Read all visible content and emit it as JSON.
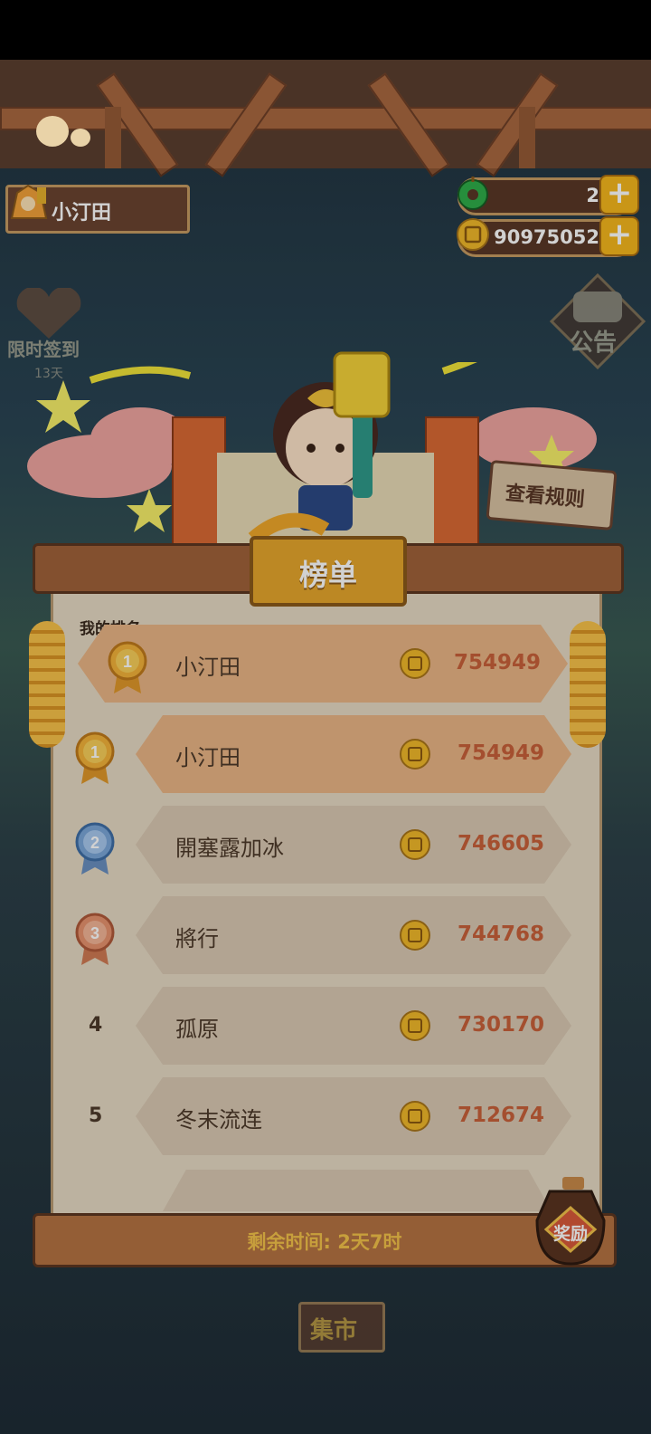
{
  "player": {
    "name": "小汀田"
  },
  "currency": {
    "jade": "2",
    "coins": "90975052"
  },
  "side": {
    "checkin_label": "限时签到",
    "checkin_days": "13天",
    "notice_label": "公告"
  },
  "rules_button": "查看规则",
  "board": {
    "title": "榜单",
    "my_rank_label": "我的排名",
    "my_entry": {
      "rank": "1",
      "name": "小汀田",
      "score": "754949"
    },
    "entries": [
      {
        "rank": "1",
        "name": "小汀田",
        "score": "754949"
      },
      {
        "rank": "2",
        "name": "開塞露加冰",
        "score": "746605"
      },
      {
        "rank": "3",
        "name": "將行",
        "score": "744768"
      },
      {
        "rank": "4",
        "name": "孤原",
        "score": "730170"
      },
      {
        "rank": "5",
        "name": "冬末流连",
        "score": "712674"
      }
    ]
  },
  "footer": {
    "remaining": "剩余时间: 2天7时",
    "reward": "奖励"
  },
  "market": "集市",
  "colors": {
    "row_highlight": "#e9b585",
    "row_normal": "#d9c8b2",
    "score": "#c8613a",
    "gold": "#f1b92a"
  }
}
